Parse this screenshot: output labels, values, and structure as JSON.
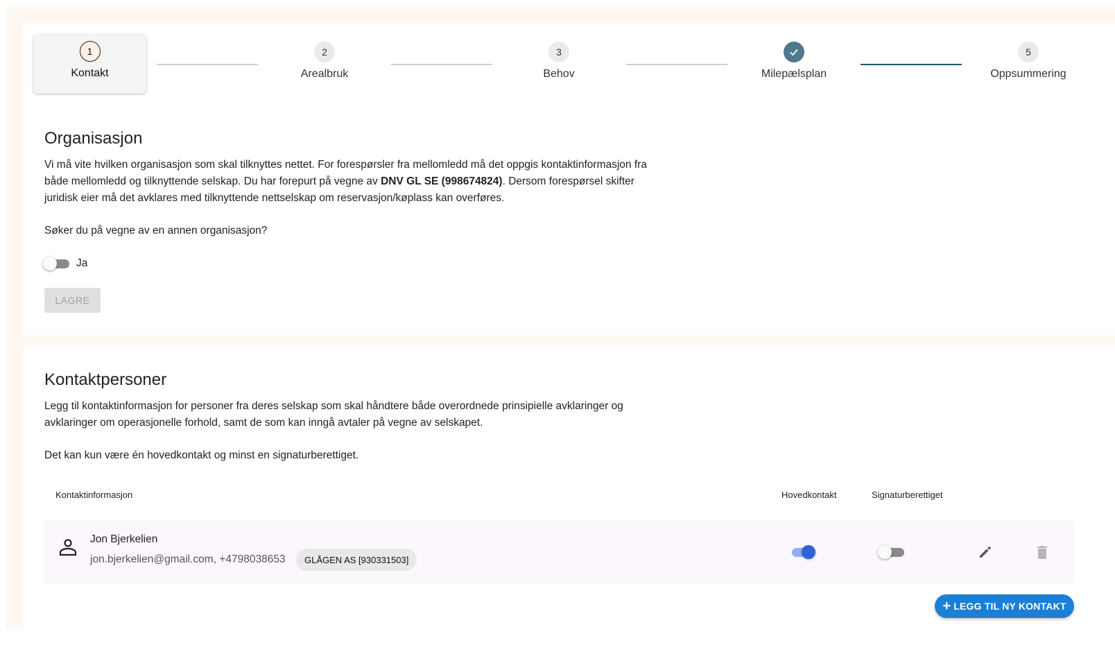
{
  "stepper": {
    "steps": [
      {
        "number": "1",
        "label": "Kontakt",
        "state": "active"
      },
      {
        "number": "2",
        "label": "Arealbruk",
        "state": "pending"
      },
      {
        "number": "3",
        "label": "Behov",
        "state": "pending"
      },
      {
        "number": "",
        "label": "Milepælsplan",
        "state": "completed",
        "icon": "check-icon"
      },
      {
        "number": "5",
        "label": "Oppsummering",
        "state": "pending"
      }
    ]
  },
  "organisation": {
    "title": "Organisasjon",
    "description_part1": "Vi må vite hvilken organisasjon som skal tilknyttes nettet. For forespørsler fra mellomledd må det oppgis kontaktinformasjon fra både mellomledd og tilknyttende selskap. Du har forepurt på vegne av ",
    "org_name": "DNV GL SE (998674824)",
    "description_part2": ". Dersom forespørsel skifter juridisk eier må det avklares med tilknyttende nettselskap om reservasjon/køplass kan overføres.",
    "question": "Søker du på vegne av en annen organisasjon?",
    "toggle_label": "Ja",
    "toggle_on": false,
    "save_label": "LAGRE"
  },
  "contacts": {
    "title": "Kontaktpersoner",
    "description": "Legg til kontaktinformasjon for personer fra deres selskap som skal håndtere både overordnede prinsipielle avklaringer og avklaringer om operasjonelle forhold, samt de som kan inngå avtaler på vegne av selskapet.",
    "rule": "Det kan kun være én hovedkontakt og minst en signaturberettiget.",
    "columns": {
      "info": "Kontaktinformasjon",
      "main": "Hovedkontakt",
      "signature": "Signaturberettiget"
    },
    "rows": [
      {
        "name": "Jon Bjerkelien",
        "details": "jon.bjerkelien@gmail.com, +4798038653",
        "company": "GLÅGEN AS [930331503]",
        "main_contact": true,
        "signature": false,
        "icon": "person-icon"
      }
    ],
    "add_label": "LEGG TIL NY KONTAKT"
  },
  "colors": {
    "accent": "#1c7fd6",
    "completed_step": "#4e7a8c",
    "toggle_on": "#2f63d8",
    "background": "#fdf8f2"
  }
}
